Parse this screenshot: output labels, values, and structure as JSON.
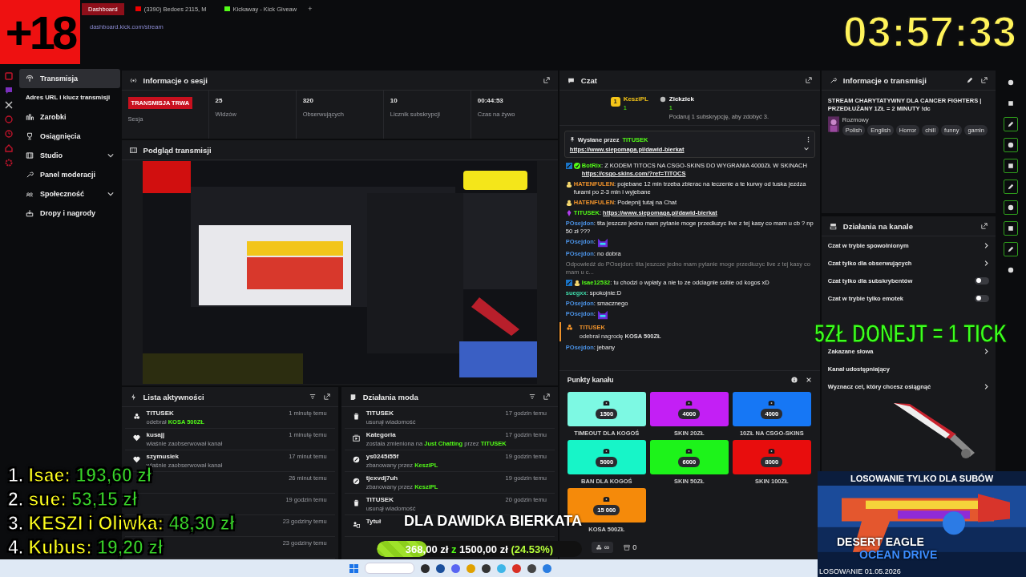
{
  "browser": {
    "tabs": [
      {
        "label": "Dashboard",
        "selected": true,
        "kind": "kick"
      },
      {
        "label": "(3390) Bedoes 2115, M",
        "selected": false,
        "kind": "video"
      },
      {
        "label": "Kickaway - Kick Giveaw",
        "selected": false,
        "kind": "gift"
      }
    ],
    "new_tab": "+",
    "address": "dashboard.kick.com/stream"
  },
  "sidebar": {
    "items": [
      {
        "label": "Transmisja",
        "selected": true,
        "kind": "link",
        "children": [
          {
            "label": "Adres URL i klucz transmisji",
            "selected": false
          }
        ]
      },
      {
        "label": "Zarobki",
        "selected": false,
        "kind": "link"
      },
      {
        "label": "Osiągnięcia",
        "selected": false,
        "kind": "link"
      },
      {
        "label": "Studio",
        "selected": false,
        "kind": "group"
      },
      {
        "label": "Panel moderacji",
        "selected": false,
        "kind": "link"
      },
      {
        "label": "Społeczność",
        "selected": false,
        "kind": "group"
      },
      {
        "label": "Dropy i nagrody",
        "selected": false,
        "kind": "link"
      }
    ]
  },
  "session": {
    "title": "Informacje o sesji",
    "status": "TRANSMISJA TRWA",
    "status_label": "Sesja",
    "stats": [
      {
        "value": "25",
        "label": "Widzów"
      },
      {
        "value": "320",
        "label": "Obserwujących"
      },
      {
        "value": "10",
        "label": "Licznik subskrypcji"
      },
      {
        "value": "00:44:53",
        "label": "Czas na żywo"
      }
    ]
  },
  "preview": {
    "title": "Podgląd transmisji",
    "kind": "picture"
  },
  "activity": {
    "title": "Lista aktywności",
    "rows": [
      {
        "kind": "reward",
        "user": "TITUSEK",
        "detail": "odebrał **KOSA 500ZŁ**",
        "time": "1 minutę temu"
      },
      {
        "kind": "follow",
        "user": "kusajj",
        "detail": "właśnie zaobserwował kanał",
        "time": "1 minutę temu"
      },
      {
        "kind": "follow",
        "user": "szymusiek",
        "detail": "właśnie zaobserwował kanał",
        "time": "17 minut temu"
      },
      {
        "time": "26 minut temu"
      },
      {
        "time": "19 godzin temu"
      },
      {
        "time": "23 godziny temu"
      },
      {
        "time": "23 godziny temu"
      }
    ]
  },
  "mod_actions": {
    "title": "Działania moda",
    "rows": [
      {
        "kind": "delete",
        "user": "TITUSEK",
        "detail": "usunął wiadomość",
        "time": "17 godzin temu"
      },
      {
        "kind": "category",
        "user": "Kategoria",
        "detail": "została zmieniona na **Just Chatting** przez **TITUSEK**",
        "time": "17 godzin temu"
      },
      {
        "kind": "ban",
        "user": "ys0245i55f",
        "detail": "zbanowany przez **KesziPL**",
        "time": "19 godzin temu"
      },
      {
        "kind": "ban",
        "user": "tjexvdj7uh",
        "detail": "zbanowany przez **KesziPL**",
        "time": "19 godzin temu"
      },
      {
        "kind": "delete",
        "user": "TITUSEK",
        "detail": "usunął wiadomość",
        "time": "20 godzin temu"
      },
      {
        "kind": "title",
        "user": "Tytuł"
      }
    ]
  },
  "chat": {
    "title": "Czat",
    "leaders": [
      {
        "rank": "1",
        "name": "KesziPL",
        "count": "1",
        "color": "#f5c518"
      },
      {
        "name": "Zickzick",
        "count": "1",
        "color": "#ffffff"
      }
    ],
    "leader_hint": "Podaruj 1 subskrypcję, aby zdobyć 3.",
    "pinned": {
      "label": "Wysłane przez",
      "user": "TITUSEK",
      "link": "https://www.siepomaga.pl/dawid-bierkat"
    },
    "messages": [
      {
        "kind": "message",
        "user": "BotRix",
        "color": "#53fc18",
        "badges": [
          {
            "kind": "mod"
          },
          {
            "kind": "verified"
          }
        ],
        "text": ": Z KODEM TITOCS NA CSGO-SKINS DO WYGRANIA 4000ZŁ W SKINACH",
        "link": "https://csgo-skins.com/?ref=TITOCS"
      },
      {
        "kind": "message",
        "user": "HATENFULEN",
        "color": "#f0932b",
        "badges": [
          {
            "kind": "sub"
          }
        ],
        "text": ": pojebane 12 min trzeba zbierac na leczenie a te kurwy od tuska jezdza furami po 2-3 min i wyjebane"
      },
      {
        "kind": "message",
        "user": "HATENFULEN",
        "color": "#f0932b",
        "badges": [
          {
            "kind": "sub"
          }
        ],
        "text": ": Podepnij tutaj na Chat"
      },
      {
        "kind": "message",
        "user": "TITUSEK",
        "color": "#53fc18",
        "badges": [
          {
            "kind": "vip"
          }
        ],
        "text": ": ",
        "link": "https://www.siepomaga.pl/dawid-bierkat"
      },
      {
        "kind": "message",
        "user": "POsejdon",
        "color": "#4a90e2",
        "text": ": tita jeszcze jedno mam pytanie moge przedłuzyc live z tej kasy co mam u cb ? np 50 zł ???"
      },
      {
        "kind": "emote",
        "user": "POsejdon",
        "color": "#4a90e2",
        "text": ":"
      },
      {
        "kind": "message",
        "user": "POsejdon",
        "color": "#4a90e2",
        "text": ": no dobra"
      },
      {
        "kind": "reply",
        "text": "Odpowiedź do POsejdon: tita jeszcze jedno mam pytanie moge przedłuzyc live z tej kasy co mam u c..."
      },
      {
        "kind": "message",
        "user": "Isae12532",
        "color": "#53fc18",
        "badges": [
          {
            "kind": "mod"
          },
          {
            "kind": "sub"
          }
        ],
        "text": ": tu chodzi o wpłaty a nie to ze odciagnie sobie od kogos xD"
      },
      {
        "kind": "message",
        "user": "suegxx",
        "color": "#3fd8a8",
        "text": ": spokojnie:D"
      },
      {
        "kind": "message",
        "user": "POsejdon",
        "color": "#4a90e2",
        "text": ": smacznego"
      },
      {
        "kind": "emote",
        "user": "POsejdon",
        "color": "#4a90e2",
        "text": ":"
      },
      {
        "kind": "reward",
        "user": "TITUSEK",
        "color": "#f0932b",
        "text": "odebrał nagrodę **KOSA 500ZŁ**"
      },
      {
        "kind": "message",
        "user": "POsejdon",
        "color": "#4a90e2",
        "text": ": jebany"
      }
    ]
  },
  "channel_points": {
    "title": "Punkty kanału",
    "rewards": [
      {
        "cost": "1500",
        "label": "TIMEOUT DLA KOGOŚ",
        "color": "#7df9e3"
      },
      {
        "cost": "4000",
        "label": "SKIN 20ZŁ",
        "color": "#c31ff5"
      },
      {
        "cost": "4000",
        "label": "10ZŁ NA CSGO-SKINS",
        "color": "#1677f5"
      },
      {
        "cost": "5000",
        "label": "BAN DLA KOGOŚ",
        "color": "#17f5c8"
      },
      {
        "cost": "6000",
        "label": "SKIN 50ZŁ",
        "color": "#1df31a"
      },
      {
        "cost": "8000",
        "label": "SKIN 100ZŁ",
        "color": "#e80d0d"
      },
      {
        "cost": "15 000",
        "label": "KOSA 500ZŁ",
        "color": "#f58a0a"
      }
    ],
    "points": "∞",
    "store_count": "0"
  },
  "stream_info": {
    "title": "Informacje o transmisji",
    "stream_title": "STREAM CHARYTATYWNY DLA CANCER FIGHTERS | PRZEDŁUŻANY 1ZŁ = 2 MINUTY !dc",
    "category": "Rozmowy",
    "tags": [
      "Polish",
      "English",
      "Horror",
      "chill",
      "funny",
      "gamin"
    ]
  },
  "channel_actions": {
    "title": "Działania na kanale",
    "rows": [
      {
        "label": "Czat w trybie spowolnionym",
        "kind": "chevron"
      },
      {
        "label": "Czat tylko dla obserwujących",
        "kind": "chevron"
      },
      {
        "label": "Czat tylko dla subskrybentów",
        "kind": "toggle",
        "on": false
      },
      {
        "label": "Czat w trybie tylko emotek",
        "kind": "toggle",
        "on": false
      },
      {
        "label": "Zakazane słowa",
        "kind": "chevron"
      },
      {
        "label": "Kanał udostępniający",
        "kind": "plain"
      },
      {
        "label": "Wyznacz cel, który chcesz osiągnąć",
        "kind": "chevron"
      }
    ]
  },
  "tool_rail": [
    {
      "highlighted": false
    },
    {
      "highlighted": false
    },
    {
      "highlighted": true
    },
    {
      "highlighted": true
    },
    {
      "highlighted": true
    },
    {
      "highlighted": true
    },
    {
      "highlighted": true
    },
    {
      "highlighted": true
    },
    {
      "highlighted": true
    },
    {
      "highlighted": false
    }
  ],
  "overlay": {
    "age_badge": "+18",
    "timer": "03:57:33",
    "donate_banner": "5ZŁ DONEJT = 1 TICK",
    "leaderboard": [
      {
        "rank": "1.",
        "name": "Isae:",
        "amount": "193,60 zł"
      },
      {
        "rank": "2.",
        "name": "sue:",
        "amount": "53,15 zł"
      },
      {
        "rank": "3.",
        "name": "KESZI i Oliwka:",
        "amount": "48,30 zł"
      },
      {
        "rank": "4.",
        "name": "Kubus:",
        "amount": "19,20 zł"
      }
    ],
    "goal": {
      "title": "DLA DAWIDKA BIERKATA",
      "current": "368,00 zł",
      "of": "z",
      "total": "1500,00 zł",
      "percent": "(24.53%)",
      "level": 0.2453
    },
    "giveaway": {
      "title": "LOSOWANIE TYLKO DLA SUBÓW",
      "item": "DESERT EAGLE",
      "skin": "OCEAN DRIVE",
      "date": "LOSOWANIE 01.05.2026"
    }
  }
}
